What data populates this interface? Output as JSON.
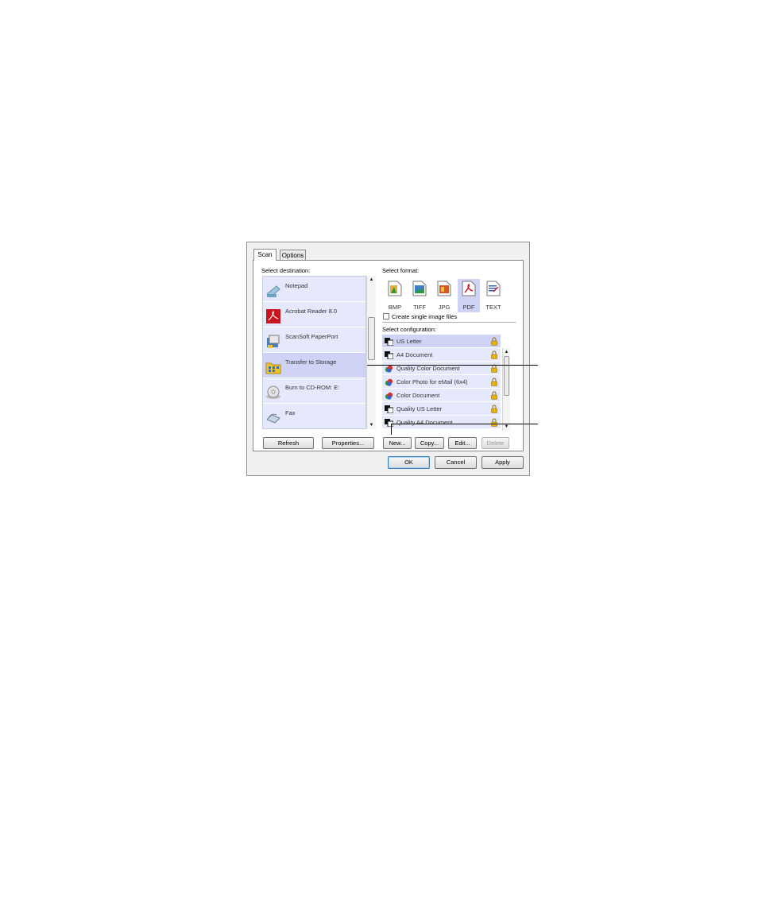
{
  "tabs": [
    {
      "label": "Scan"
    },
    {
      "label": "Options"
    }
  ],
  "labels": {
    "select_destination": "Select destination:",
    "select_format": "Select format:",
    "create_single": "Create single image files",
    "select_configuration": "Select configuration:"
  },
  "destinations": [
    {
      "label": "Notepad",
      "icon": "notepad-icon"
    },
    {
      "label": "Acrobat Reader 8.0",
      "icon": "acrobat-icon"
    },
    {
      "label": "ScanSoft PaperPort",
      "icon": "paperport-icon"
    },
    {
      "label": "Transfer to Storage",
      "icon": "folder-icon",
      "selected": true
    },
    {
      "label": "Burn to CD-ROM: E:",
      "icon": "cd-icon"
    },
    {
      "label": "Fax",
      "icon": "fax-icon"
    }
  ],
  "formats": [
    {
      "label": "BMP",
      "icon": "bmp-icon"
    },
    {
      "label": "TIFF",
      "icon": "tiff-icon"
    },
    {
      "label": "JPG",
      "icon": "jpg-icon"
    },
    {
      "label": "PDF",
      "icon": "pdf-icon",
      "selected": true
    },
    {
      "label": "TEXT",
      "icon": "text-icon"
    }
  ],
  "configurations": [
    {
      "label": "US Letter",
      "icon": "bw-page-icon",
      "selected": true
    },
    {
      "label": "A4 Document",
      "icon": "bw-page-icon"
    },
    {
      "label": "Quality Color Document",
      "icon": "color-icon"
    },
    {
      "label": "Color Photo for eMail (6x4)",
      "icon": "color-icon"
    },
    {
      "label": "Color Document",
      "icon": "color-icon"
    },
    {
      "label": "Quality US Letter",
      "icon": "bw-page-icon"
    },
    {
      "label": "Quality A4 Document",
      "icon": "bw-page-icon"
    }
  ],
  "buttons": {
    "refresh": "Refresh",
    "properties": "Properties...",
    "new": "New...",
    "copy": "Copy...",
    "edit": "Edit...",
    "delete": "Delete",
    "ok": "OK",
    "cancel": "Cancel",
    "apply": "Apply"
  },
  "colors": {
    "list_bg": "#e6e9fb",
    "selected_bg": "#cfd3f6",
    "lock": "#e8b010"
  }
}
